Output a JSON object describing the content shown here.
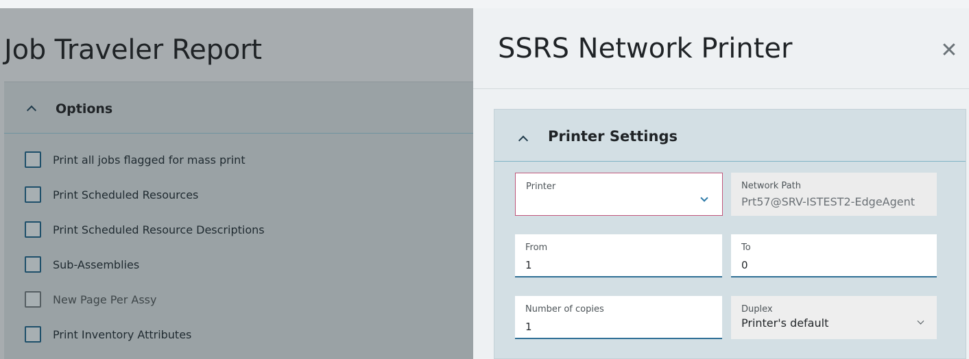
{
  "background_page": {
    "title": "Job Traveler Report",
    "options_section": {
      "title": "Options",
      "items": [
        {
          "label": "Print all jobs flagged for mass print",
          "checked": false,
          "disabled": false
        },
        {
          "label": "Print Scheduled Resources",
          "checked": false,
          "disabled": false
        },
        {
          "label": "Print Scheduled Resource Descriptions",
          "checked": false,
          "disabled": false
        },
        {
          "label": "Sub-Assemblies",
          "checked": false,
          "disabled": false
        },
        {
          "label": "New Page Per Assy",
          "checked": false,
          "disabled": true
        },
        {
          "label": "Print Inventory Attributes",
          "checked": false,
          "disabled": false
        }
      ]
    }
  },
  "flyout": {
    "title": "SSRS Network Printer",
    "close_icon": "close-icon",
    "printer_settings": {
      "title": "Printer Settings",
      "printer": {
        "label": "Printer",
        "value": ""
      },
      "network_path": {
        "label": "Network Path",
        "value": "Prt57@SRV-ISTEST2-EdgeAgent"
      },
      "from": {
        "label": "From",
        "value": "1"
      },
      "to": {
        "label": "To",
        "value": "0"
      },
      "copies": {
        "label": "Number of copies",
        "value": "1"
      },
      "duplex": {
        "label": "Duplex",
        "value": "Printer's default"
      }
    }
  },
  "colors": {
    "accent": "#2f6f95",
    "required_border": "#c0557a",
    "overlay": "#a7acaf"
  }
}
